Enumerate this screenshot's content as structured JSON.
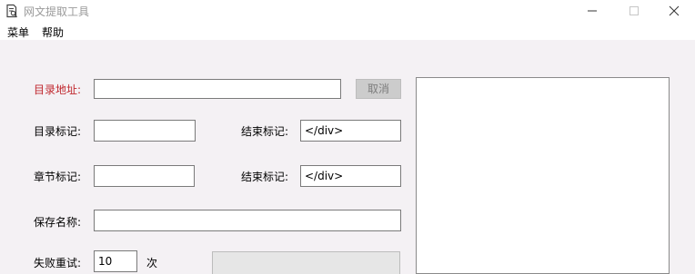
{
  "window": {
    "title": "网文提取工具"
  },
  "menu": {
    "items": [
      "菜单",
      "帮助"
    ]
  },
  "form": {
    "dir_address": {
      "label": "目录地址:",
      "value": ""
    },
    "cancel_label": "取消",
    "dir_mark": {
      "label": "目录标记:",
      "value": ""
    },
    "dir_end": {
      "label": "结束标记:",
      "value": "</div>"
    },
    "chapter_mark": {
      "label": "章节标记:",
      "value": ""
    },
    "chapter_end": {
      "label": "结束标记:",
      "value": "</div>"
    },
    "save_name": {
      "label": "保存名称:",
      "value": ""
    },
    "retry": {
      "label": "失败重试:",
      "value": "10",
      "unit": "次"
    }
  },
  "log": {
    "text": ""
  },
  "progress": {
    "fraction": 0
  },
  "colors": {
    "label_highlight": "#c0282e",
    "client_bg": "#f4f1f4"
  }
}
